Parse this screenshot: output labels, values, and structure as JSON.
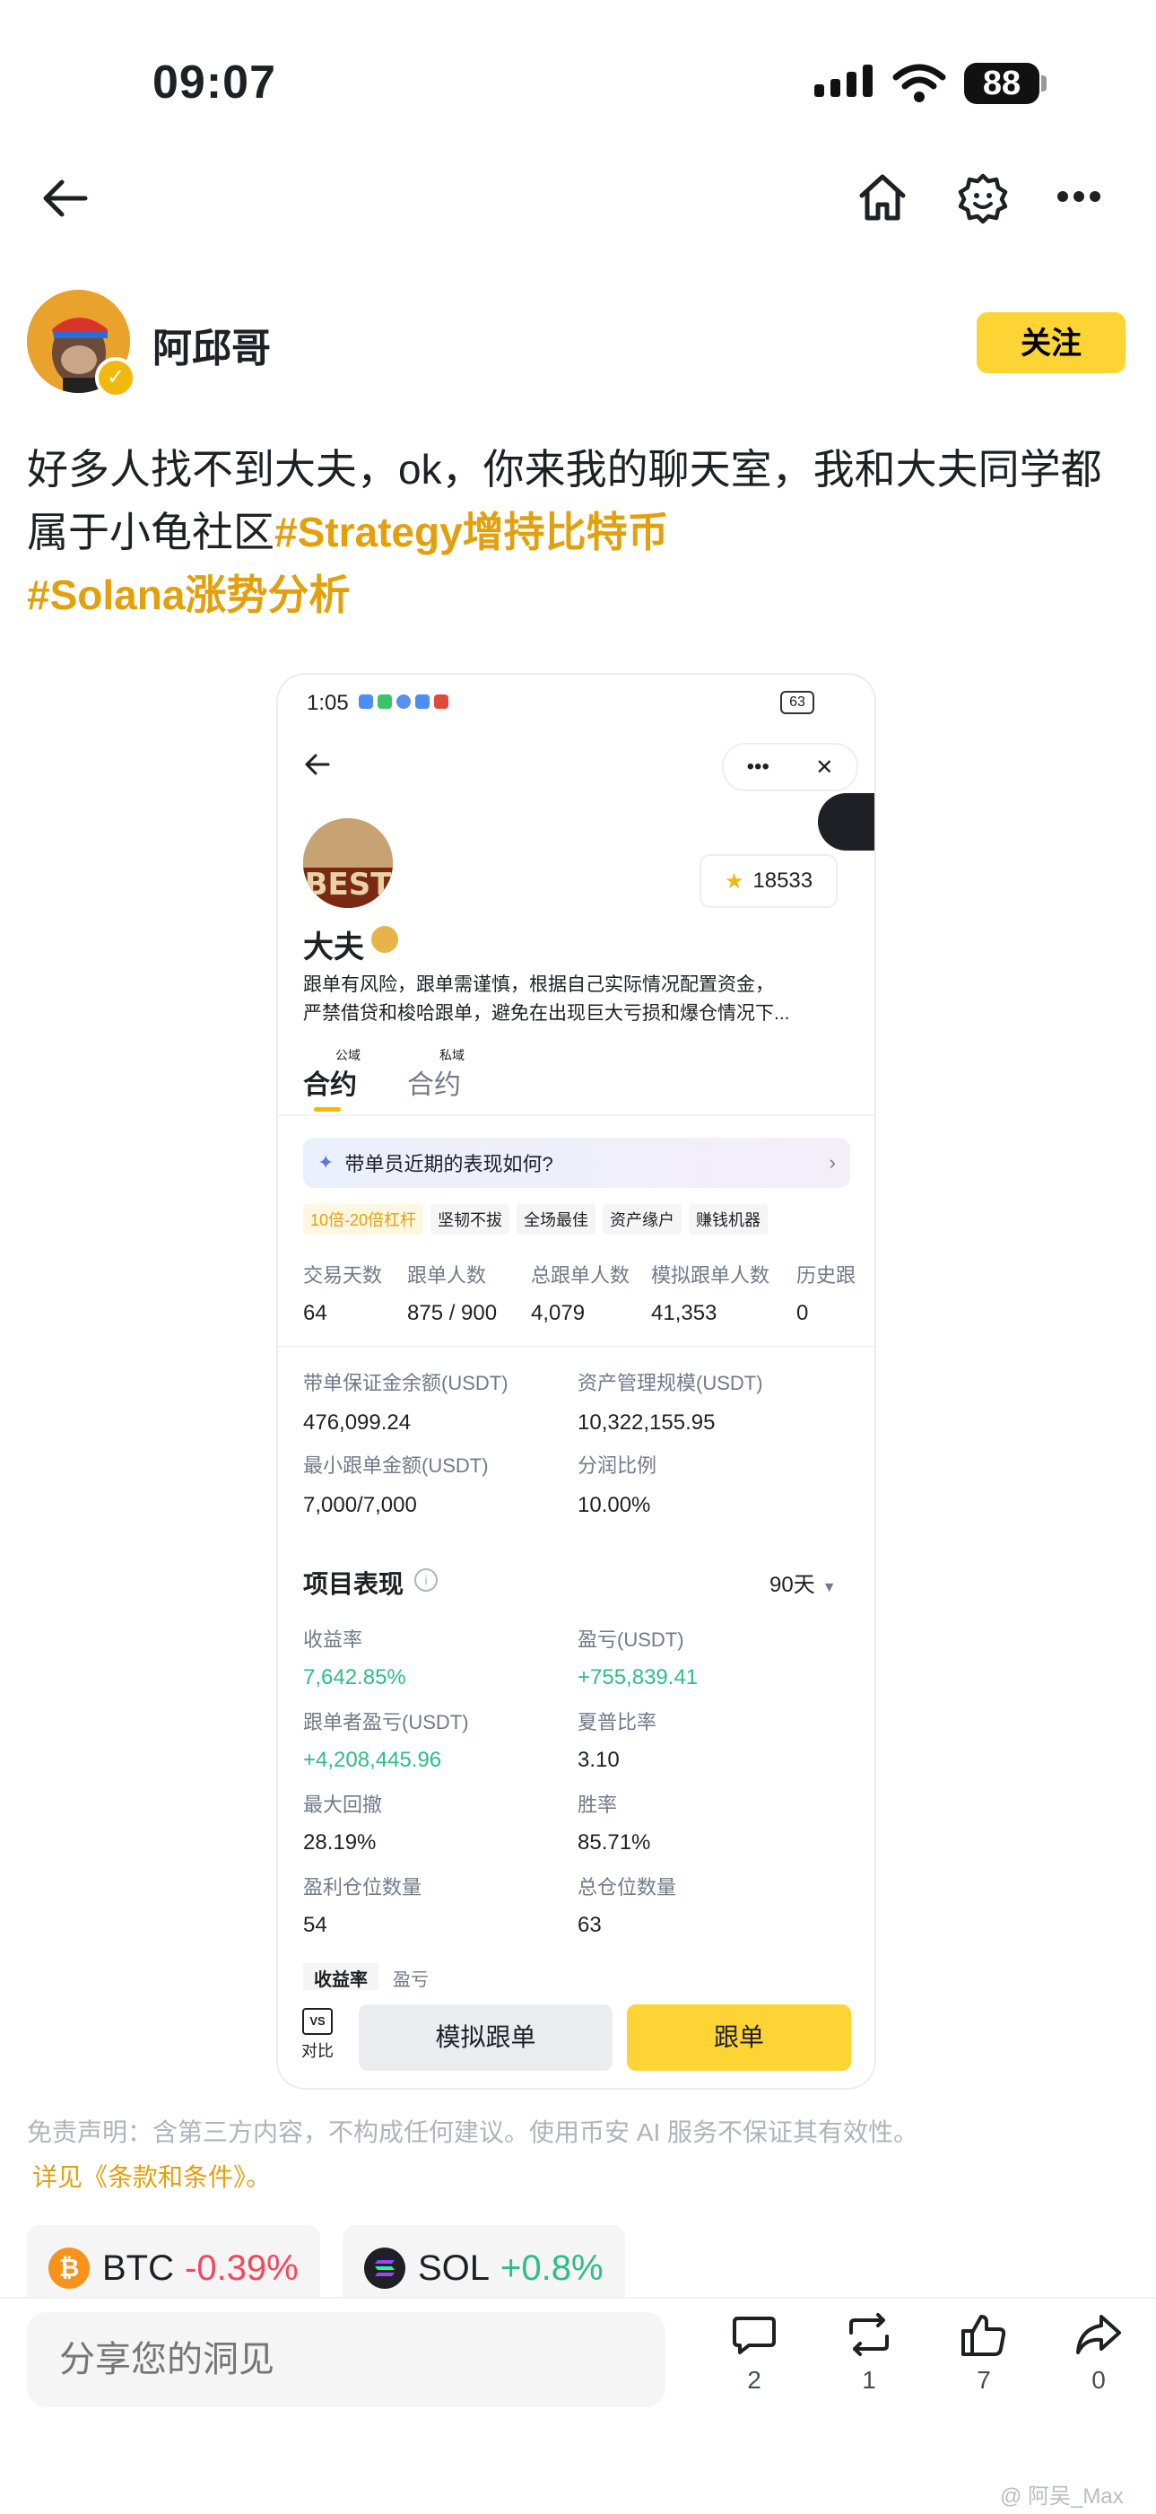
{
  "status_bar": {
    "time": "09:07",
    "battery": "88"
  },
  "author": {
    "name": "阿邱哥",
    "follow_label": "关注"
  },
  "post": {
    "text": "好多人找不到大夫，ok，你来我的聊天室，我和大夫同学都属于小龟社区",
    "tags": [
      "#Strategy增持比特币",
      "#Solana涨势分析"
    ]
  },
  "embedded": {
    "time": "1:05",
    "battery": "63",
    "trader_name": "大夫",
    "followers": "18533",
    "bio_line1": "跟单有风险，跟单需谨慎，根据自己实际情况配置资金，",
    "bio_line2": "严禁借贷和梭哈跟单，避免在出现巨大亏损和爆仓情况下...",
    "tabs": [
      {
        "sup": "公域",
        "label": "合约"
      },
      {
        "sup": "私域",
        "label": "合约"
      }
    ],
    "banner": "带单员近期的表现如何?",
    "chips": [
      "10倍-20倍杠杆",
      "坚韧不拔",
      "全场最佳",
      "资产缘户",
      "赚钱机器"
    ],
    "stats": [
      {
        "label": "交易天数",
        "value": "64"
      },
      {
        "label": "跟单人数",
        "value": "875 / 900"
      },
      {
        "label": "总跟单人数",
        "value": "4,079"
      },
      {
        "label": "模拟跟单人数",
        "value": "41,353"
      },
      {
        "label": "历史跟",
        "value": "0"
      }
    ],
    "balance": [
      {
        "label": "带单保证金余额(USDT)",
        "value": "476,099.24"
      },
      {
        "label": "资产管理规模(USDT)",
        "value": "10,322,155.95"
      },
      {
        "label": "最小跟单金额(USDT)",
        "value": "7,000/7,000"
      },
      {
        "label": "分润比例",
        "value": "10.00%"
      }
    ],
    "perf_title": "项目表现",
    "period": "90天",
    "perf": [
      {
        "label": "收益率",
        "value": "7,642.85%",
        "green": true
      },
      {
        "label": "盈亏(USDT)",
        "value": "+755,839.41",
        "green": true
      },
      {
        "label": "跟单者盈亏(USDT)",
        "value": "+4,208,445.96",
        "green": true
      },
      {
        "label": "夏普比率",
        "value": "3.10",
        "green": false
      },
      {
        "label": "最大回撤",
        "value": "28.19%",
        "green": false
      },
      {
        "label": "胜率",
        "value": "85.71%",
        "green": false
      },
      {
        "label": "盈利仓位数量",
        "value": "54",
        "green": false
      },
      {
        "label": "总仓位数量",
        "value": "63",
        "green": false
      }
    ],
    "bottom_tabs": [
      "收益率",
      "盈亏"
    ],
    "compare_label": "对比",
    "sim_button": "模拟跟单",
    "copy_button": "跟单"
  },
  "disclaimer": {
    "text": "免责声明：含第三方内容，不构成任何建议。使用币安 AI 服务不保证其有效性。",
    "link": "详见《条款和条件》。"
  },
  "coins": [
    {
      "symbol": "BTC",
      "change": "-0.39%",
      "color": "#f6465d"
    },
    {
      "symbol": "SOL",
      "change": "+0.8%",
      "color": "#2ebd85"
    }
  ],
  "bottom_bar": {
    "placeholder": "分享您的洞见",
    "comments": "2",
    "reposts": "1",
    "likes": "7",
    "shares": "0"
  },
  "watermark": "@ 阿吴_Max"
}
